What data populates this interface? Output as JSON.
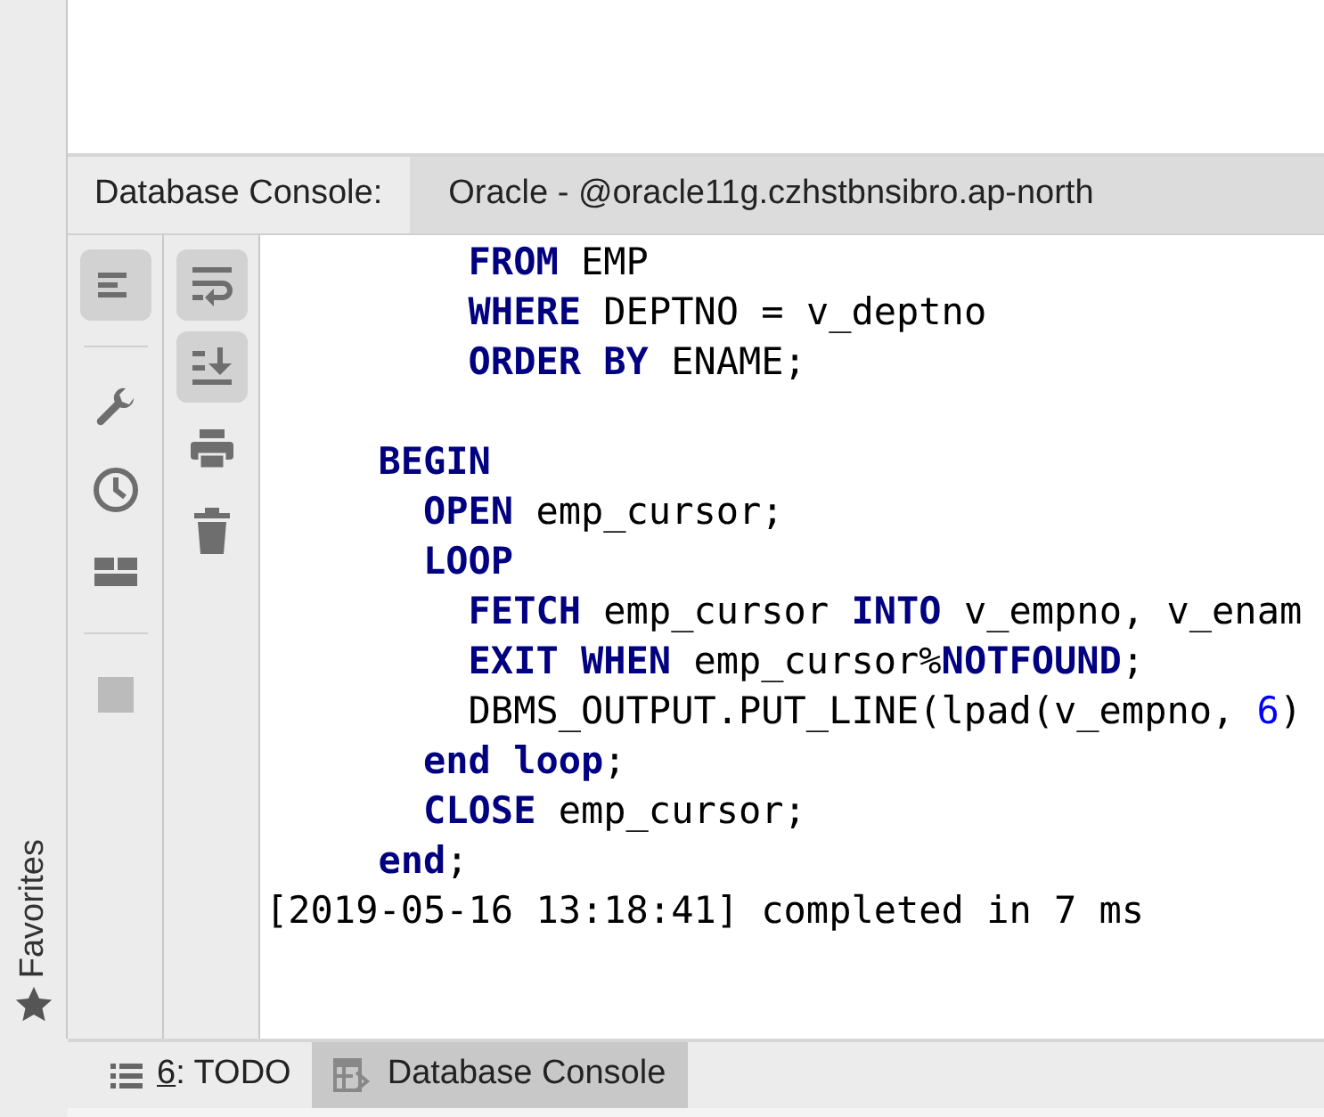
{
  "console_header": {
    "title": "Database Console:",
    "tabs": [
      {
        "label": "Oracle - @oracle11g.czhstbnsibro.ap-north",
        "selected": true
      }
    ]
  },
  "left_toolbar": [
    {
      "kind": "lines",
      "selected": true
    },
    {
      "kind": "separator"
    },
    {
      "kind": "wrench",
      "selected": false
    },
    {
      "kind": "clock",
      "selected": false
    },
    {
      "kind": "layout",
      "selected": false
    },
    {
      "kind": "separator"
    },
    {
      "kind": "stop",
      "selected": false,
      "disabled": true
    }
  ],
  "right_toolbar": [
    {
      "kind": "wrap",
      "selected": true
    },
    {
      "kind": "scroll-end",
      "selected": true
    },
    {
      "kind": "print",
      "selected": false
    },
    {
      "kind": "trash",
      "selected": false
    }
  ],
  "code_blocks": [
    {
      "lines": [
        {
          "tokens": [
            {
              "kind": "keyword",
              "text": "         FROM"
            },
            {
              "kind": "plain",
              "text": " EMP"
            }
          ]
        },
        {
          "tokens": [
            {
              "kind": "keyword",
              "text": "         WHERE"
            },
            {
              "kind": "plain",
              "text": " DEPTNO = v_deptno"
            }
          ]
        },
        {
          "tokens": [
            {
              "kind": "keyword",
              "text": "         ORDER BY"
            },
            {
              "kind": "plain",
              "text": " ENAME;"
            }
          ]
        }
      ]
    },
    {
      "lines": [
        {
          "tokens": [
            {
              "kind": "keyword",
              "text": "     BEGIN"
            }
          ]
        },
        {
          "tokens": [
            {
              "kind": "keyword",
              "text": "       OPEN"
            },
            {
              "kind": "plain",
              "text": " emp_cursor;"
            }
          ]
        },
        {
          "tokens": [
            {
              "kind": "keyword",
              "text": "       LOOP"
            }
          ]
        },
        {
          "tokens": [
            {
              "kind": "keyword",
              "text": "         FETCH"
            },
            {
              "kind": "plain",
              "text": " emp_cursor "
            },
            {
              "kind": "keyword",
              "text": "INTO"
            },
            {
              "kind": "plain",
              "text": " v_empno, v_enam"
            }
          ]
        },
        {
          "tokens": [
            {
              "kind": "keyword",
              "text": "         EXIT WHEN"
            },
            {
              "kind": "plain",
              "text": " emp_cursor%"
            },
            {
              "kind": "keyword",
              "text": "NOTFOUND"
            },
            {
              "kind": "plain",
              "text": ";"
            }
          ]
        },
        {
          "tokens": [
            {
              "kind": "plain",
              "text": "         DBMS_OUTPUT.PUT_LINE(lpad(v_empno, "
            },
            {
              "kind": "number",
              "text": "6"
            },
            {
              "kind": "plain",
              "text": ")"
            }
          ]
        },
        {
          "tokens": [
            {
              "kind": "keyword",
              "text": "       end loop"
            },
            {
              "kind": "plain",
              "text": ";"
            }
          ]
        },
        {
          "tokens": [
            {
              "kind": "keyword",
              "text": "       CLOSE"
            },
            {
              "kind": "plain",
              "text": " emp_cursor;"
            }
          ]
        },
        {
          "tokens": [
            {
              "kind": "keyword",
              "text": "     end"
            },
            {
              "kind": "plain",
              "text": ";"
            }
          ]
        },
        {
          "tokens": [
            {
              "kind": "plain",
              "text": "[2019-05-16 13:18:41] completed in 7 ms"
            }
          ]
        }
      ]
    }
  ],
  "side_panel": {
    "label": "Favorites"
  },
  "bottom_tabs": [
    {
      "kind": "list",
      "mnemonic": "6",
      "label": ": TODO",
      "selected": false
    },
    {
      "kind": "console",
      "label": "Database Console",
      "selected": true
    }
  ]
}
